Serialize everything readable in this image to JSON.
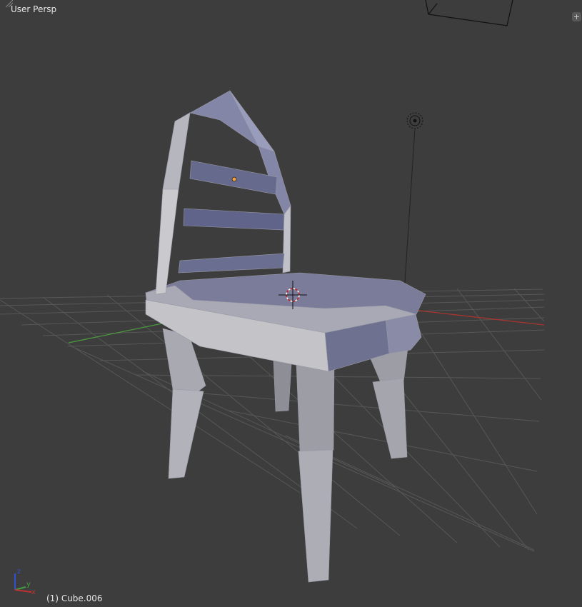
{
  "viewport": {
    "view_name": "User Persp",
    "active_object": "(1) Cube.006",
    "axis_labels": {
      "x": "x",
      "y": "y",
      "z": "z"
    },
    "toggle_icon": "+"
  },
  "colors": {
    "background": "#3d3d3d",
    "grid": "#555555",
    "x_axis": "#a8342f",
    "y_axis": "#4c9a3e",
    "mesh_light": "#b8b8c0",
    "mesh_dark": "#6c6f8f",
    "origin": "#f0a040"
  }
}
